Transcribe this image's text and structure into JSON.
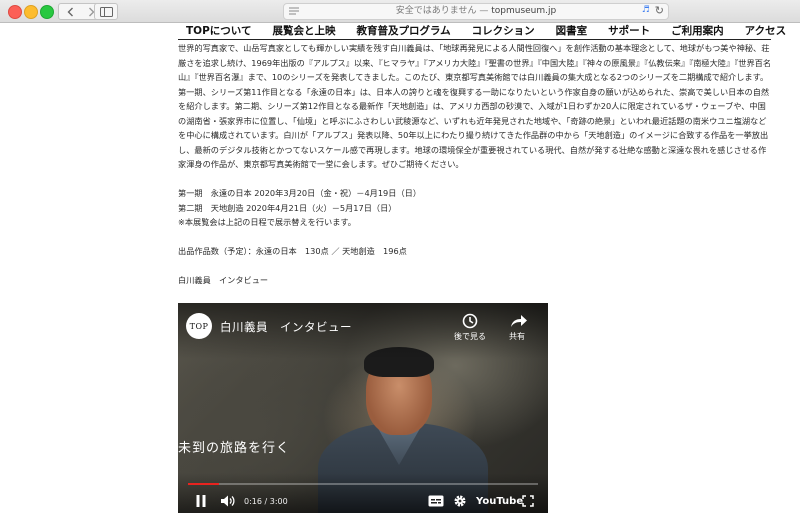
{
  "browser": {
    "address_warning": "安全ではありません — ",
    "address_domain": "topmuseum.jp",
    "back_icon": "chevron-left-icon",
    "forward_icon": "chevron-right-icon"
  },
  "site_nav": {
    "items": [
      "TOPについて",
      "展覧会と上映",
      "教育普及プログラム",
      "コレクション",
      "図書室",
      "サポート",
      "ご利用案内",
      "アクセス"
    ]
  },
  "article": {
    "intro": "世界的写真家で、山岳写真家としても輝かしい実績を残す白川義員は、「地球再発見による人間性回復へ」を創作活動の基本理念として、地球がもつ美や神秘、荘厳さを追求し続け、1969年出版の『アルプス』以来、『ヒマラヤ』『アメリカ大陸』『聖書の世界』『中国大陸』『神々の原風景』『仏教伝来』『南極大陸』『世界百名山』『世界百名瀑』まで、10のシリーズを発表してきました。このたび、東京都写真美術館では白川義員の集大成となる2つのシリーズを二期構成で紹介します。第一期、シリーズ第11作目となる「永遠の日本」は、日本人の誇りと魂を復興する一助になりたいという作家自身の願いが込められた、崇高で美しい日本の自然を紹介します。第二期、シリーズ第12作目となる最新作「天地創造」は、アメリカ西部の砂漠で、入域が1日わずか20人に限定されているザ・ウェーブや、中国の湖南省・張家界市に位置し、「仙境」と呼ぶにふさわしい武稜源など、いずれも近年発見された地域や、「奇跡の絶景」といわれ最近話題の南米ウユニ塩湖などを中心に構成されています。白川が「アルプス」発表以降、50年以上にわたり撮り続けてきた作品群の中から「天地創造」のイメージに合致する作品を一挙放出し、最新のデジタル技術とかつてないスケール感で再現します。地球の環境保全が重要視されている現代、自然が発する壮絶な感動と深遠な畏れを感じさせる作家渾身の作品が、東京都写真美術館で一堂に会します。ぜひご期待ください。",
    "schedule_1": "第一期　永遠の日本 2020年3月20日（金・祝）－4月19日（日）",
    "schedule_2": "第二期　天地創造 2020年4月21日（火）－5月17日（日）",
    "schedule_note": "※本展覧会は上記の日程で展示替えを行います。",
    "works_count": "出品作品数（予定）：永遠の日本　130点 ／ 天地創造　196点",
    "video_caption": "白川義員　インタビュー"
  },
  "video": {
    "channel_logo": "TOP",
    "title": "白川義員　インタビュー",
    "watch_later_label": "後で見る",
    "share_label": "共有",
    "subtitle_text": "未到の旅路を行く",
    "time_display": "0:16 / 3:00",
    "progress_fraction": 0.089,
    "youtube_label": "YouTube",
    "accent_color": "#e8231f"
  }
}
